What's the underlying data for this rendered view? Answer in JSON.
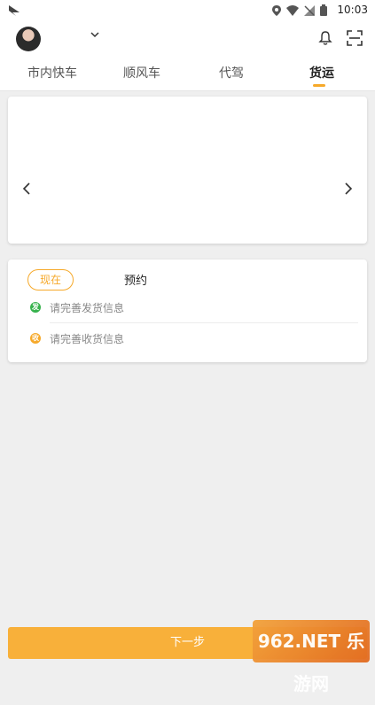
{
  "status_bar": {
    "time": "10:03",
    "icons": [
      "location-icon",
      "wifi-icon",
      "signal-off-icon",
      "battery-icon"
    ]
  },
  "header": {
    "tabs": [
      {
        "label": "市内快车",
        "active": false
      },
      {
        "label": "顺风车",
        "active": false
      },
      {
        "label": "代驾",
        "active": false
      },
      {
        "label": "货运",
        "active": true
      }
    ]
  },
  "order_card": {
    "now_label": "现在",
    "reserve_label": "预约",
    "send_badge": "发",
    "send_placeholder": "请完善发货信息",
    "recv_badge": "收",
    "recv_placeholder": "请完善收货信息"
  },
  "footer": {
    "next_label": "下一步",
    "watermark": "962.NET 乐游网"
  },
  "colors": {
    "accent": "#f6a92a",
    "button": "#f8b03a",
    "send": "#37b24d"
  }
}
